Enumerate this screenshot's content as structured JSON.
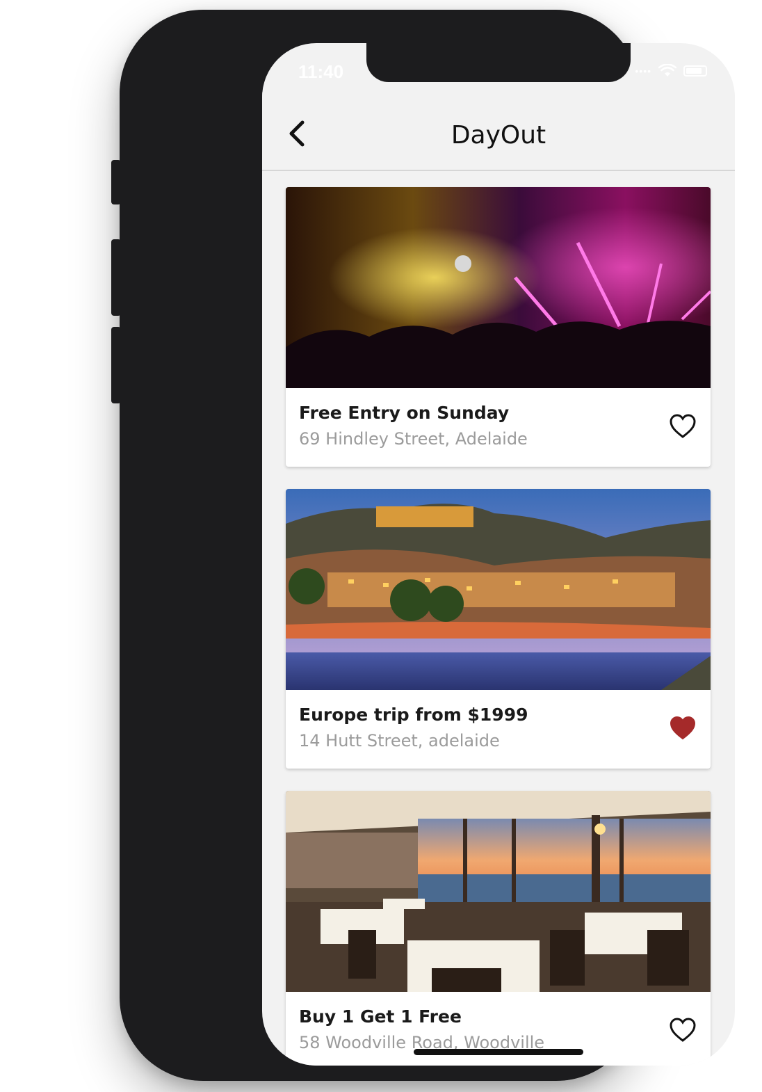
{
  "status_bar": {
    "time": "11:40"
  },
  "nav": {
    "title": "DayOut",
    "back_icon": "chevron-left-icon"
  },
  "colors": {
    "favorite_active": "#a52a2a",
    "favorite_inactive": "#111111",
    "screen_bg": "#f2f2f2"
  },
  "offers": [
    {
      "title": "Free Entry on Sunday",
      "address": "69 Hindley Street, Adelaide",
      "favorited": false,
      "image": "nightclub-crowd-photo"
    },
    {
      "title": "Europe trip from $1999",
      "address": "14 Hutt Street, adelaide",
      "favorited": true,
      "image": "riverside-town-night-photo"
    },
    {
      "title": "Buy 1 Get 1 Free",
      "address": "58 Woodville Road, Woodville",
      "favorited": false,
      "image": "restaurant-ocean-view-photo"
    }
  ]
}
